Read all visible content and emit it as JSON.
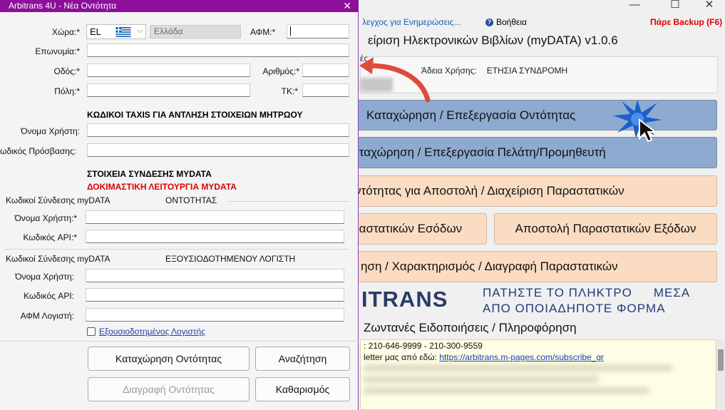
{
  "main": {
    "menu": {
      "updates": "λεγχος για Ενημερώσεις...",
      "help": "Βοήθεια",
      "backup": "Πάρε Backup (F6)"
    },
    "window_controls": {
      "minimize": "—",
      "maximize": "☐",
      "close": "✕"
    },
    "app_title": "είριση Ηλεκτρονικών Βιβλίων (myDATA) v1.0.6",
    "info_fragment": "ές",
    "license_label": "Άδεια Χρήσης:",
    "license_value": "ΕΤΗΣΙΑ ΣΥΝΔΡΟΜΗ",
    "buttons": {
      "entity": "Καταχώρηση / Επεξεργασία Οντότητας",
      "client": "αταχώρηση / Επεξεργασία Πελάτη/Προμηθευτή",
      "send": "ντότητας για  Αποστολή / Διαχείριση Παραστατικών",
      "income": "ραστατικών Εσόδων",
      "expense": "Αποστολή Παραστατικών Εξόδων",
      "characterize": "ηση / Χαρακτηρισμός / Διαγραφή Παραστατικών"
    },
    "brand": "ITRANS",
    "notice_line1a": "ΠΑΤΗΣΤΕ ΤΟ ΠΛΗΚΤΡΟ",
    "notice_line1b": "ΜΕΣΑ",
    "notice_line2": "ΑΠΟ ΟΠΟΙΑΔΗΠΟΤΕ ΦΟΡΜΑ",
    "live_title": "Ζωντανές Ειδοποιήσεις / Πληροφόρηση",
    "news_phone": ": 210-646-9999 - 210-300-9559",
    "news_link_prefix": "letter μας από εδώ: ",
    "news_link": "https://arbitrans.m-pages.com/subscribe_gr",
    "colors": {
      "accent_blue": "#8eaad0",
      "accent_peach": "#fbdcc2",
      "titlebar": "#8b0f9b",
      "backup_red": "#e00000"
    }
  },
  "dialog": {
    "title": "Arbitrans 4U - Νέα Οντότητα",
    "close": "✕",
    "country_label": "Χώρα:*",
    "country_code": "EL",
    "country_name": "Ελλάδα",
    "afm_label": "ΑΦΜ:*",
    "afm_value": "",
    "name_label": "Επωνυμία:*",
    "street_label": "Οδός:*",
    "number_label": "Αριθμός:*",
    "city_label": "Πόλη:*",
    "zip_label": "ΤΚ:*",
    "taxis_heading": "ΚΩΔΙΚΟΙ TAXIS ΓΙΑ ΑΝΤΛΗΣΗ ΣΤΟΙΧΕΙΩΝ ΜΗΤΡΩΟΥ",
    "taxis_user_label": "Όνομα Χρήστη:",
    "taxis_pass_label": "ωδικός Πρόσβασης:",
    "mydata_heading": "ΣΤΟΙΧΕΙΑ ΣΥΝΔΕΣΗΣ MYDATA",
    "mydata_test_heading": "ΔΟΚΙΜΑΣΤΙΚΗ ΛΕΙΤΟΥΡΓΙΑ MYDATA",
    "entity_group_label": "Κωδικοί Σύνδεσης myDATA",
    "entity_group_sub": "ΟΝΤΟΤΗΤΑΣ",
    "entity_user_label": "Όνομα Χρήστη:*",
    "entity_api_label": "Κωδικός API:*",
    "acc_group_label": "Κωδικοί Σύνδεσης myDATA",
    "acc_group_sub": "ΕΞΟΥΣΙΟΔΟΤΗΜΕΝΟΥ ΛΟΓΙΣΤΗ",
    "acc_user_label": "Όνομα Χρήστη:",
    "acc_api_label": "Κωδικός API:",
    "acc_afm_label": "ΑΦΜ Λογιστή:",
    "authorized_accountant": "Εξουσιοδοτημένος Λογιστής",
    "authorized_checked": false,
    "btn_save": "Καταχώρηση Οντότητας",
    "btn_search": "Αναζήτηση",
    "btn_delete": "Διαγραφή Οντότητας",
    "btn_clear": "Καθαρισμός"
  }
}
